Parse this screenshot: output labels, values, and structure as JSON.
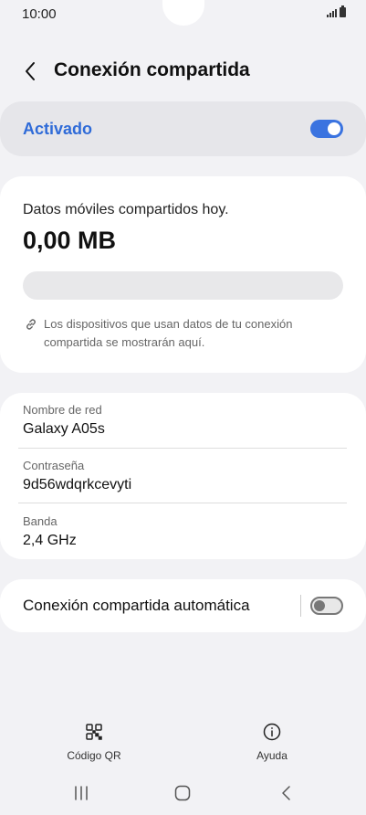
{
  "status_bar": {
    "time": "10:00",
    "icons": [
      "signal-icon",
      "battery-icon"
    ]
  },
  "header": {
    "back_icon": "chevron-left-icon",
    "title": "Conexión compartida"
  },
  "activation": {
    "label": "Activado",
    "toggle_on": true
  },
  "data_usage": {
    "label": "Datos móviles compartidos hoy.",
    "value": "0,00 MB",
    "progress_fraction": 0,
    "note_icon": "link-icon",
    "note": "Los dispositivos que usan datos de tu conexión compartida se mostrarán aquí."
  },
  "network": {
    "fields": [
      {
        "label": "Nombre de red",
        "value": "Galaxy A05s"
      },
      {
        "label": "Contraseña",
        "value": "9d56wdqrkcevyti"
      },
      {
        "label": "Banda",
        "value": "2,4 GHz"
      }
    ]
  },
  "auto_hotspot": {
    "label": "Conexión compartida automática",
    "toggle_on": false
  },
  "bottom_actions": [
    {
      "icon": "qr-code-icon",
      "label": "Código QR"
    },
    {
      "icon": "info-icon",
      "label": "Ayuda"
    }
  ],
  "navigation_bar": [
    "recent-apps-icon",
    "home-icon",
    "back-icon"
  ],
  "colors": {
    "accent": "#3a73e0",
    "activated_text": "#2f6bd8",
    "background": "#f2f2f5"
  }
}
